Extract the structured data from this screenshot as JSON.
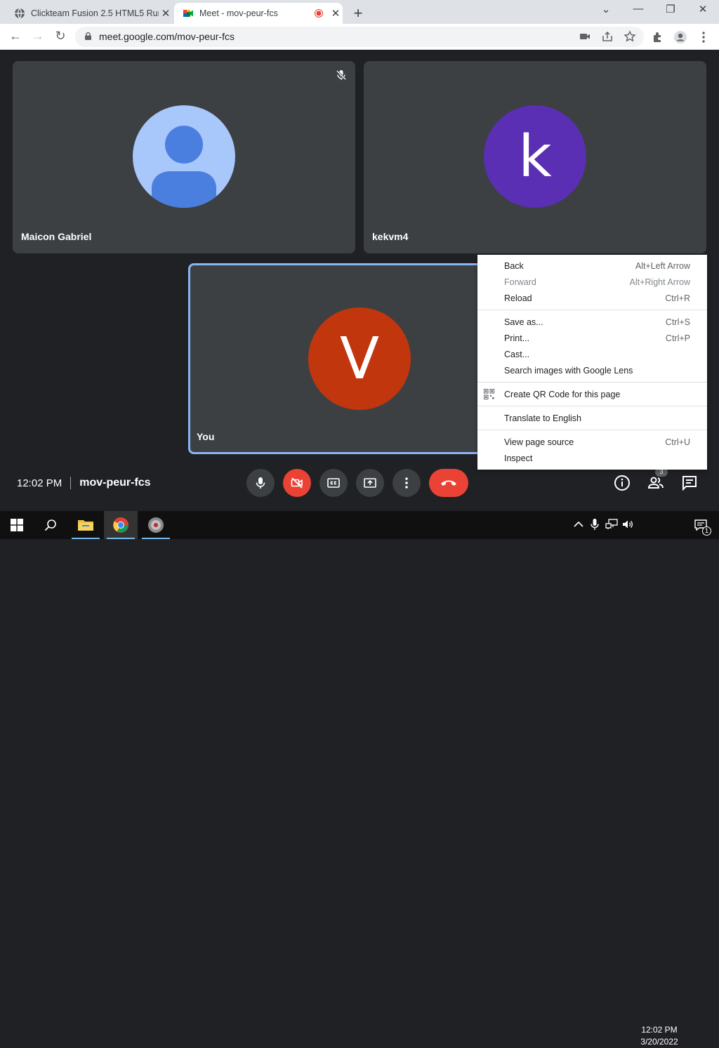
{
  "browser": {
    "tabs": [
      {
        "title": "Clickteam Fusion 2.5 HTML5 Run",
        "close": "✕",
        "active": false
      },
      {
        "title": "Meet - mov-peur-fcs",
        "close": "✕",
        "active": true
      }
    ],
    "new_tab": "+",
    "window_controls": {
      "minimize": "—",
      "restore": "❐",
      "close": "✕",
      "tab_search": "⌄"
    },
    "nav": {
      "back": "←",
      "forward": "→",
      "reload": "↻"
    },
    "url": "meet.google.com/mov-peur-fcs"
  },
  "meet": {
    "participants": [
      {
        "name": "Maicon Gabriel",
        "avatar": "person-placeholder",
        "muted": true
      },
      {
        "name": "kekvm4",
        "avatar_letter": "k",
        "avatar_color": "#5a2fb4"
      },
      {
        "name": "You",
        "avatar_letter": "V",
        "avatar_color": "#c1360d",
        "highlighted": true
      }
    ],
    "time": "12:02 PM",
    "meeting_code": "mov-peur-fcs",
    "people_count": "3",
    "colors": {
      "end_call": "#ea4335",
      "camera_off": "#ea4335",
      "tile": "#3c4043",
      "focus_border": "#8ab4f8"
    }
  },
  "context_menu": {
    "groups": [
      [
        {
          "label": "Back",
          "shortcut": "Alt+Left Arrow",
          "disabled": false
        },
        {
          "label": "Forward",
          "shortcut": "Alt+Right Arrow",
          "disabled": true
        },
        {
          "label": "Reload",
          "shortcut": "Ctrl+R",
          "disabled": false
        }
      ],
      [
        {
          "label": "Save as...",
          "shortcut": "Ctrl+S"
        },
        {
          "label": "Print...",
          "shortcut": "Ctrl+P"
        },
        {
          "label": "Cast...",
          "shortcut": ""
        },
        {
          "label": "Search images with Google Lens",
          "shortcut": ""
        }
      ],
      [
        {
          "label": "Create QR Code for this page",
          "shortcut": "",
          "icon": "qr-code-icon"
        }
      ],
      [
        {
          "label": "Translate to English",
          "shortcut": ""
        }
      ],
      [
        {
          "label": "View page source",
          "shortcut": "Ctrl+U"
        },
        {
          "label": "Inspect",
          "shortcut": ""
        }
      ]
    ]
  },
  "taskbar": {
    "clock_time": "12:02 PM",
    "clock_date": "3/20/2022",
    "notification_count": "1"
  }
}
